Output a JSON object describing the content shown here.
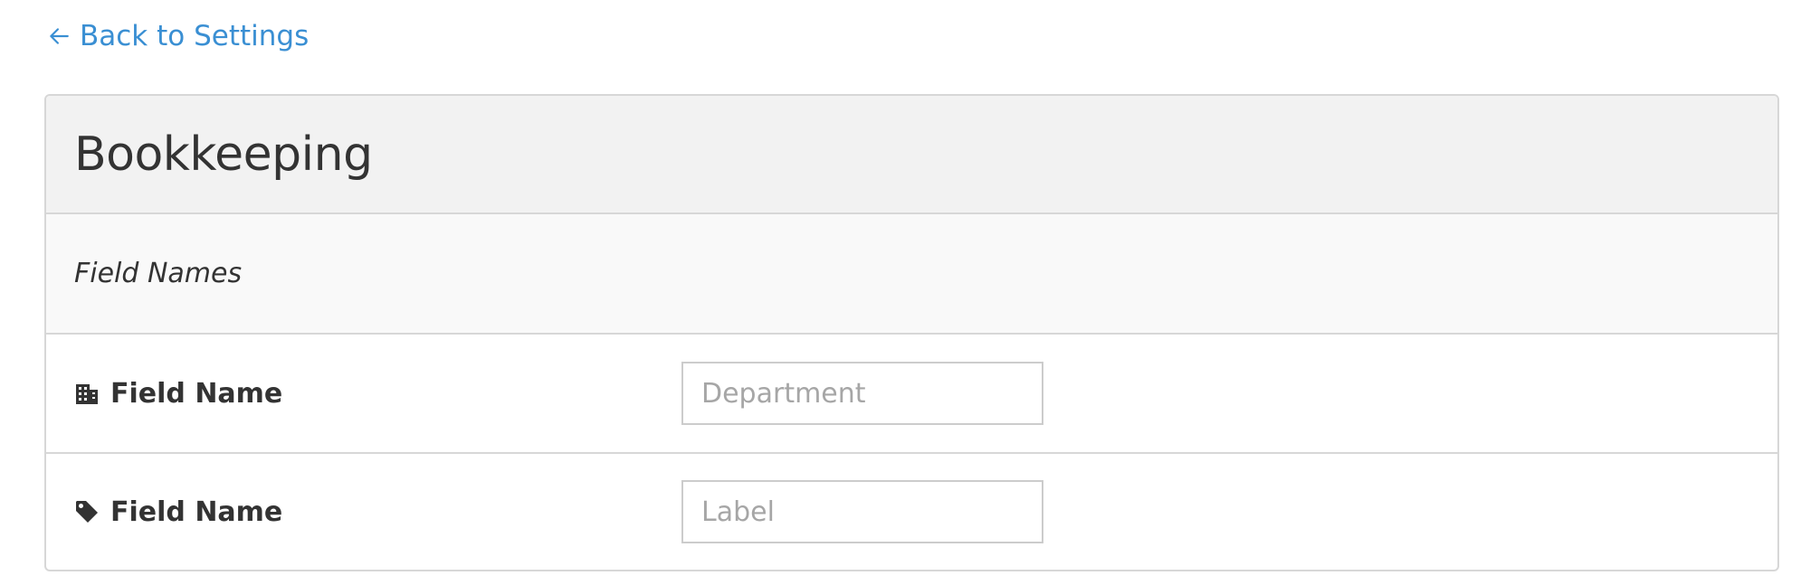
{
  "nav": {
    "back_label": "Back to Settings",
    "back_icon": "arrow-left-icon"
  },
  "panel": {
    "title": "Bookkeeping",
    "section_label": "Field Names",
    "fields": [
      {
        "icon": "building-icon",
        "label": "Field Name",
        "value": "",
        "placeholder": "Department"
      },
      {
        "icon": "tag-icon",
        "label": "Field Name",
        "value": "",
        "placeholder": "Label"
      }
    ]
  },
  "colors": {
    "link": "#3a8fd3",
    "header_bg": "#f2f2f2",
    "section_bg": "#f9f9f9",
    "border": "#d7d7d7",
    "text": "#333333",
    "placeholder": "#a6a6a6"
  }
}
